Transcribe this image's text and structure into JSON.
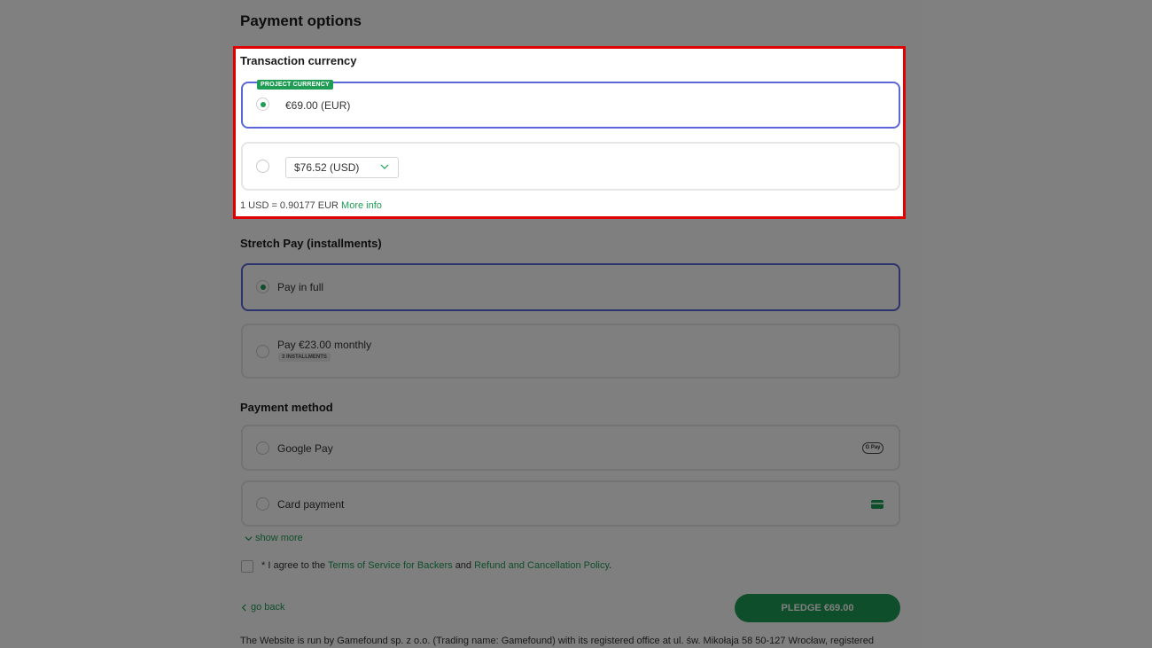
{
  "page": {
    "title": "Payment options"
  },
  "currency": {
    "heading": "Transaction currency",
    "badge": "PROJECT CURRENCY",
    "eur_label": "€69.00 (EUR)",
    "usd_value": "$76.52 (USD)",
    "rate_text": "1 USD = 0.90177 EUR",
    "more_info": "More info"
  },
  "stretch": {
    "heading": "Stretch Pay (installments)",
    "full_label": "Pay in full",
    "monthly_label": "Pay €23.00 monthly",
    "installments_tag": "3 INSTALLMENTS"
  },
  "payment_method": {
    "heading": "Payment method",
    "google_pay": "Google Pay",
    "gpay_icon_text": "G Pay",
    "card_payment": "Card payment",
    "show_more": "show more"
  },
  "agreement": {
    "prefix": "* I agree to the",
    "tos_link": "Terms of Service for Backers",
    "and": "and",
    "refund_link": "Refund and Cancellation Policy",
    "suffix": "."
  },
  "actions": {
    "go_back": "go back",
    "pledge": "PLEDGE €69.00"
  },
  "footer": {
    "text": "The Website is run by Gamefound sp. z o.o. (Trading name: Gamefound) with its registered office at ul. św. Mikołaja 58 50-127 Wrocław, registered"
  },
  "colors": {
    "accent_green": "#1f9d55",
    "selected_border": "#5a67d8",
    "highlight_red": "#e00000",
    "overlay": "#808080"
  },
  "icons": {
    "chevron": "chevron-down-icon",
    "show_more": "chevron-down-icon",
    "go_back": "chevron-left-icon",
    "gpay": "google-pay-icon",
    "card": "credit-card-icon"
  }
}
